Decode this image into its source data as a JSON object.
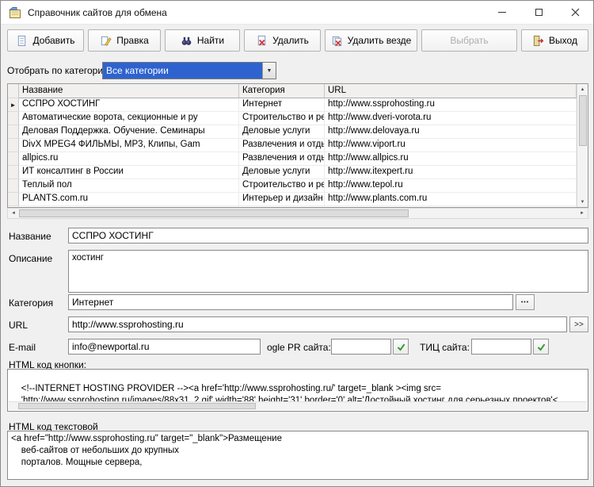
{
  "window": {
    "title": "Справочник сайтов для обмена"
  },
  "toolbar": {
    "buttons": [
      {
        "label": "Добавить",
        "enabled": true
      },
      {
        "label": "Правка",
        "enabled": true
      },
      {
        "label": "Найти",
        "enabled": true
      },
      {
        "label": "Удалить",
        "enabled": true
      },
      {
        "label": "Удалить везде",
        "enabled": true
      },
      {
        "label": "Выбрать",
        "enabled": false
      },
      {
        "label": "Выход",
        "enabled": true
      }
    ]
  },
  "filter": {
    "label": "Отобрать по категории",
    "selected_option": "Все категории"
  },
  "grid": {
    "headers": {
      "name": "Название",
      "category": "Категория",
      "url": "URL"
    },
    "rows": [
      {
        "name": "ССПРО ХОСТИНГ",
        "category": "Интернет",
        "url": "http://www.ssprohosting.ru",
        "selected": true
      },
      {
        "name": "Автоматические ворота, секционные и ру",
        "category": "Строительство и ремонт",
        "url": "http://www.dveri-vorota.ru",
        "selected": false
      },
      {
        "name": "Деловая Поддержка. Обучение. Семинары",
        "category": "Деловые услуги",
        "url": "http://www.delovaya.ru",
        "selected": false
      },
      {
        "name": "DivX MPEG4 ФИЛЬМЫ, MP3, Клипы, Gam",
        "category": "Развлечения и отдых",
        "url": "http://www.viport.ru",
        "selected": false
      },
      {
        "name": "allpics.ru",
        "category": "Развлечения и отдых",
        "url": "http://www.allpics.ru",
        "selected": false
      },
      {
        "name": "ИТ консалтинг в России",
        "category": "Деловые услуги",
        "url": "http://www.itexpert.ru",
        "selected": false
      },
      {
        "name": "Теплый пол",
        "category": "Строительство и ремонт",
        "url": "http://www.tepol.ru",
        "selected": false
      },
      {
        "name": "PLANTS.com.ru",
        "category": "Интерьер и дизайн",
        "url": "http://www.plants.com.ru",
        "selected": false
      }
    ],
    "row_marker": "►"
  },
  "form": {
    "name_label": "Название",
    "name_value": "ССПРО ХОСТИНГ",
    "desc_label": "Описание",
    "desc_value": "хостинг",
    "cat_label": "Категория",
    "cat_value": "Интернет",
    "cat_button": "•••",
    "url_label": "URL",
    "url_value": "http://www.ssprohosting.ru",
    "url_button": ">>",
    "email_label": "E-mail",
    "email_value": "info@newportal.ru",
    "pr_label": "ogle PR сайта:",
    "pr_value": "",
    "tic_label": "ТИЦ сайта:",
    "tic_value": "",
    "html_button_label": "HTML код кнопки:",
    "html_button_value": "<!--INTERNET HOSTING PROVIDER --><a href='http://www.ssprohosting.ru/' target=_blank ><img src=\n    'http://www.ssprohosting.ru/images/88x31_2.gif' width='88' height='31' border='0' alt='Достойный хостинг для серьезных проектов'<",
    "html_text_label": "HTML код текстовой",
    "html_text_value": "<a href=\"http://www.ssprohosting.ru\" target=\"_blank\">Размещение\n    веб-сайтов от небольших до крупных\n    порталов. Мощные сервера,"
  },
  "colors": {
    "combo_selection_blue": "#2e63cf",
    "check_green": "#2e9e2e",
    "delete_red": "#d23b3b"
  }
}
